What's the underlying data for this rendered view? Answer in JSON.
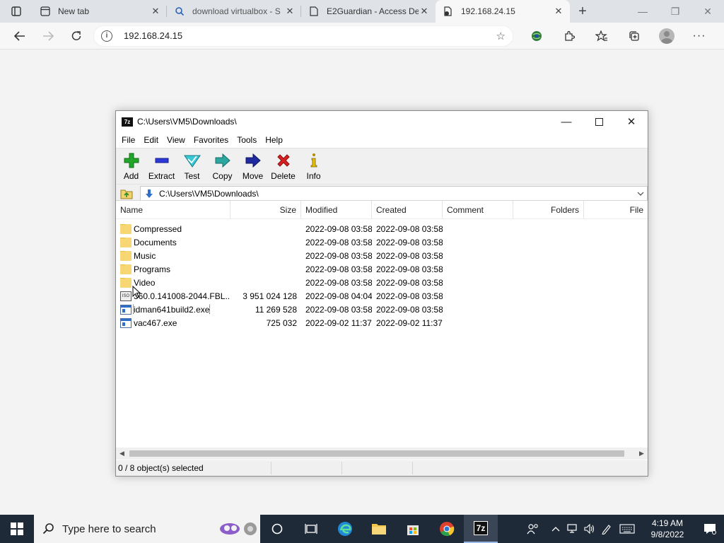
{
  "browser": {
    "tabs": [
      {
        "title": "New tab",
        "icon": "new-tab-icon"
      },
      {
        "title": "download virtualbox - S",
        "icon": "search-icon"
      },
      {
        "title": "E2Guardian - Access De",
        "icon": "document-icon"
      },
      {
        "title": "192.168.24.15",
        "icon": "page-warning-icon"
      }
    ],
    "address": "192.168.24.15"
  },
  "zip": {
    "title": "C:\\Users\\VM5\\Downloads\\",
    "menu": [
      "File",
      "Edit",
      "View",
      "Favorites",
      "Tools",
      "Help"
    ],
    "toolbar": [
      "Add",
      "Extract",
      "Test",
      "Copy",
      "Move",
      "Delete",
      "Info"
    ],
    "path": "C:\\Users\\VM5\\Downloads\\",
    "columns": [
      "Name",
      "Size",
      "Modified",
      "Created",
      "Comment",
      "Folders",
      "File"
    ],
    "files": [
      {
        "name": "Compressed",
        "size": "",
        "modified": "2022-09-08 03:58",
        "created": "2022-09-08 03:58",
        "type": "folder"
      },
      {
        "name": "Documents",
        "size": "",
        "modified": "2022-09-08 03:58",
        "created": "2022-09-08 03:58",
        "type": "folder"
      },
      {
        "name": "Music",
        "size": "",
        "modified": "2022-09-08 03:58",
        "created": "2022-09-08 03:58",
        "type": "folder"
      },
      {
        "name": "Programs",
        "size": "",
        "modified": "2022-09-08 03:58",
        "created": "2022-09-08 03:58",
        "type": "folder"
      },
      {
        "name": "Video",
        "size": "",
        "modified": "2022-09-08 03:58",
        "created": "2022-09-08 03:58",
        "type": "folder"
      },
      {
        "name": "360.0.141008-2044.FBL...",
        "size": "3 951 024 128",
        "modified": "2022-09-08 04:04",
        "created": "2022-09-08 03:58",
        "type": "iso"
      },
      {
        "name": "idman641build2.exe",
        "size": "11 269 528",
        "modified": "2022-09-08 03:58",
        "created": "2022-09-08 03:58",
        "type": "exe"
      },
      {
        "name": "vac467.exe",
        "size": "725 032",
        "modified": "2022-09-02 11:37",
        "created": "2022-09-02 11:37",
        "type": "exe"
      }
    ],
    "status": "0 / 8 object(s) selected"
  },
  "taskbar": {
    "search_placeholder": "Type here to search",
    "time": "4:19 AM",
    "date": "9/8/2022"
  }
}
